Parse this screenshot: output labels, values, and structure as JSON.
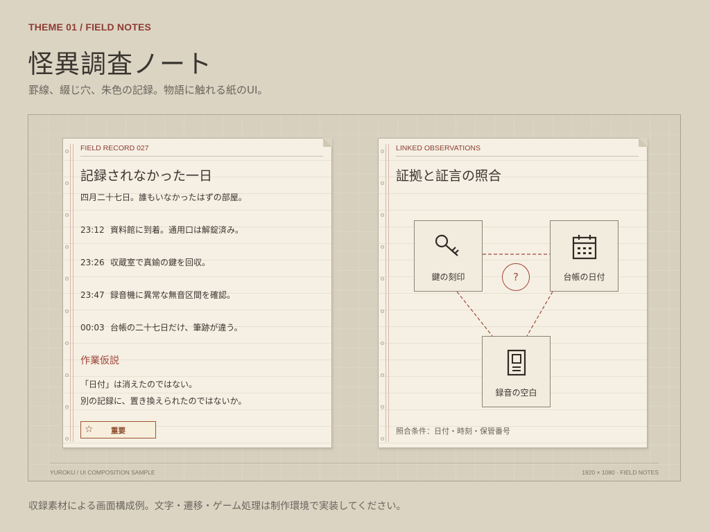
{
  "header": {
    "theme_tag": "THEME 01 / FIELD NOTES",
    "title": "怪異調査ノート",
    "subtitle": "罫線、綴じ穴、朱色の記録。物語に触れる紙のUI。"
  },
  "record_card": {
    "label": "FIELD RECORD  027",
    "title": "記録されなかった一日",
    "intro": "四月二十七日。誰もいなかったはずの部屋。",
    "entries": [
      {
        "time": "23:12",
        "text": "資料館に到着。通用口は解錠済み。"
      },
      {
        "time": "23:26",
        "text": "収蔵室で真鍮の鍵を回収。"
      },
      {
        "time": "23:47",
        "text": "録音機に異常な無音区間を確認。"
      },
      {
        "time": "00:03",
        "text": "台帳の二十七日だけ、筆跡が違う。"
      }
    ],
    "hypothesis_title": "作業仮説",
    "hypothesis_lines": [
      "「日付」は消えたのではない。",
      "別の記録に、置き換えられたのではないか。"
    ],
    "important_label": "重要",
    "important_icon": "star-outline-icon"
  },
  "observation_card": {
    "label": "LINKED OBSERVATIONS",
    "title": "証拠と証言の照合",
    "nodes": [
      {
        "label": "鍵の刻印",
        "icon": "key-icon"
      },
      {
        "label": "台帳の日付",
        "icon": "calendar-icon"
      },
      {
        "label": "録音の空白",
        "icon": "recorder-icon"
      }
    ],
    "unknown_symbol": "?",
    "conditions": "照合条件：日付・時刻・保管番号"
  },
  "frame_footer": {
    "left": "YUROKU / UI COMPOSITION SAMPLE",
    "right": "1920 × 1080 · FIELD NOTES"
  },
  "bottom_note": "収録素材による画面構成例。文字・遷移・ゲーム処理は制作環境で実装してください。",
  "colors": {
    "background": "#dcd4c3",
    "paper": "#f5f0e3",
    "accent_red": "#8d3b33",
    "link_dashed": "#a0473b"
  }
}
